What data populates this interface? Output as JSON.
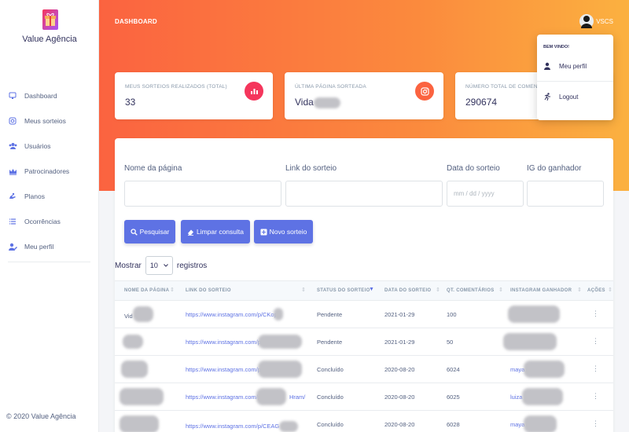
{
  "brand": {
    "name": "Value Agência",
    "footer": "© 2020 Value Agência"
  },
  "sidebar": {
    "items": [
      {
        "label": "Dashboard",
        "icon": "monitor-icon"
      },
      {
        "label": "Meus sorteios",
        "icon": "instagram-icon"
      },
      {
        "label": "Usuários",
        "icon": "users-icon"
      },
      {
        "label": "Patrocinadores",
        "icon": "crown-icon"
      },
      {
        "label": "Planos",
        "icon": "hand-icon"
      },
      {
        "label": "Ocorrências",
        "icon": "list-icon"
      },
      {
        "label": "Meu perfil",
        "icon": "user-edit-icon"
      }
    ]
  },
  "header": {
    "title": "DASHBOARD",
    "user": "VSCS"
  },
  "stats": [
    {
      "label": "MEUS SORTEIOS REALIZADOS (TOTAL)",
      "value": "33",
      "icon": "chart-bar-icon",
      "color": "#f5365c"
    },
    {
      "label": "ÚLTIMA PÁGINA SORTEADA",
      "value": "Vida",
      "icon": "instagram-icon",
      "color": "#fb6340"
    },
    {
      "label": "NÚMERO TOTAL DE COMENTÁ",
      "value": "290674",
      "icon": "",
      "color": ""
    }
  ],
  "user_menu": {
    "heading": "BEM VINDO!",
    "items": [
      {
        "label": "Meu perfil",
        "icon": "user-icon"
      },
      {
        "label": "Logout",
        "icon": "running-icon"
      }
    ]
  },
  "filters": {
    "page_name": {
      "label": "Nome da página",
      "placeholder": ""
    },
    "link": {
      "label": "Link do sorteio",
      "placeholder": ""
    },
    "date": {
      "label": "Data do sorteio",
      "placeholder": "mm / dd / yyyy"
    },
    "ig_winner": {
      "label": "IG do ganhador",
      "placeholder": ""
    }
  },
  "buttons": {
    "search": "Pesquisar",
    "clear": "Limpar consulta",
    "new": "Novo sorteio"
  },
  "length": {
    "prefix": "Mostrar",
    "value": "10",
    "suffix": "registros"
  },
  "table": {
    "headers": [
      "NOME DA PÁGINA",
      "LINK DO SORTEIO",
      "STATUS DO SORTEIO",
      "DATA DO SORTEIO",
      "QT. COMENTÁRIOS",
      "INSTAGRAM GANHADOR",
      "AÇÕES"
    ],
    "rows": [
      {
        "page": "Vid",
        "link": "https://www.instagram.com/p/CKop",
        "status": "Pendente",
        "date": "2021-01-29",
        "comments": "100",
        "ig": ""
      },
      {
        "page": "",
        "link": "https://www.instagram.com/p/",
        "status": "Pendente",
        "date": "2021-01-29",
        "comments": "50",
        "ig": ""
      },
      {
        "page": "",
        "link": "https://www.instagram.com/p/",
        "status": "Concluído",
        "date": "2020-08-20",
        "comments": "6024",
        "ig": "maya"
      },
      {
        "page": "",
        "link": "https://www.instagram.com/p/",
        "link_tail": "Hram/",
        "status": "Concluído",
        "date": "2020-08-20",
        "comments": "6025",
        "ig": "luiza"
      },
      {
        "page": "",
        "link": "https://www.instagram.com/p/CEAG",
        "status": "Concluído",
        "date": "2020-08-20",
        "comments": "6028",
        "ig": "maya"
      }
    ]
  }
}
